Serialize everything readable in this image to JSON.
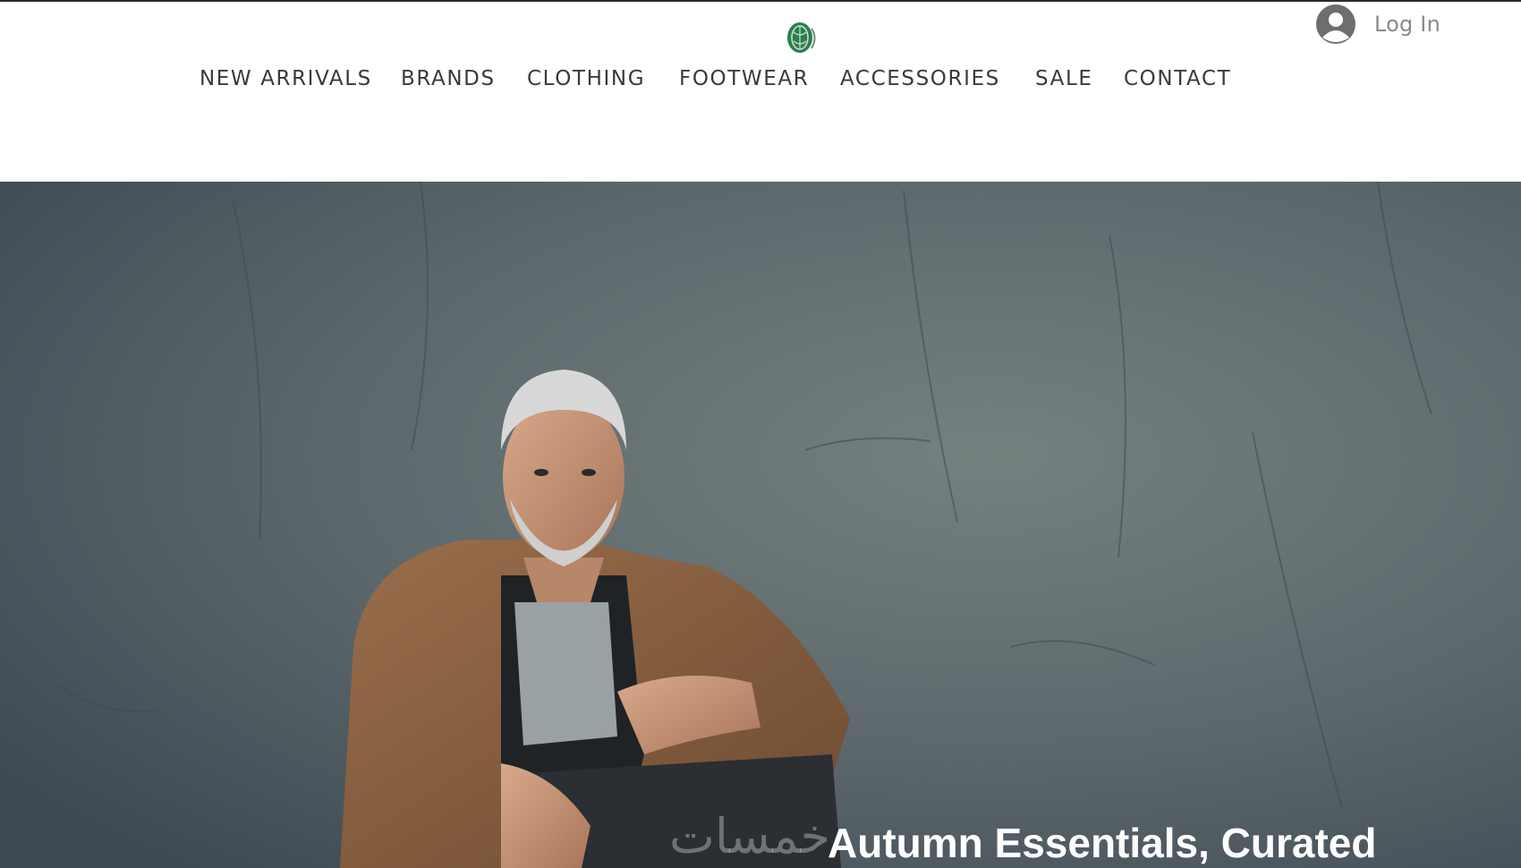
{
  "header": {
    "logo_icon": "leaf-emblem-icon",
    "login": {
      "icon": "user-avatar-icon",
      "label": "Log In"
    },
    "nav": [
      {
        "label": "NEW ARRIVALS"
      },
      {
        "label": "BRANDS"
      },
      {
        "label": "CLOTHING"
      },
      {
        "label": "FOOTWEAR"
      },
      {
        "label": "ACCESSORIES"
      },
      {
        "label": "SALE"
      },
      {
        "label": "CONTACT"
      }
    ]
  },
  "hero": {
    "image": "man-in-brown-cardigan-photo",
    "title": "Autumn Essentials, Curated",
    "watermark": "خمسات"
  },
  "colors": {
    "nav_text": "#3a3a3a",
    "login_text": "#8a8a8a",
    "hero_background": "#5f6a6e",
    "cardigan": "#8b6244",
    "logo_green": "#2e7d4f"
  }
}
